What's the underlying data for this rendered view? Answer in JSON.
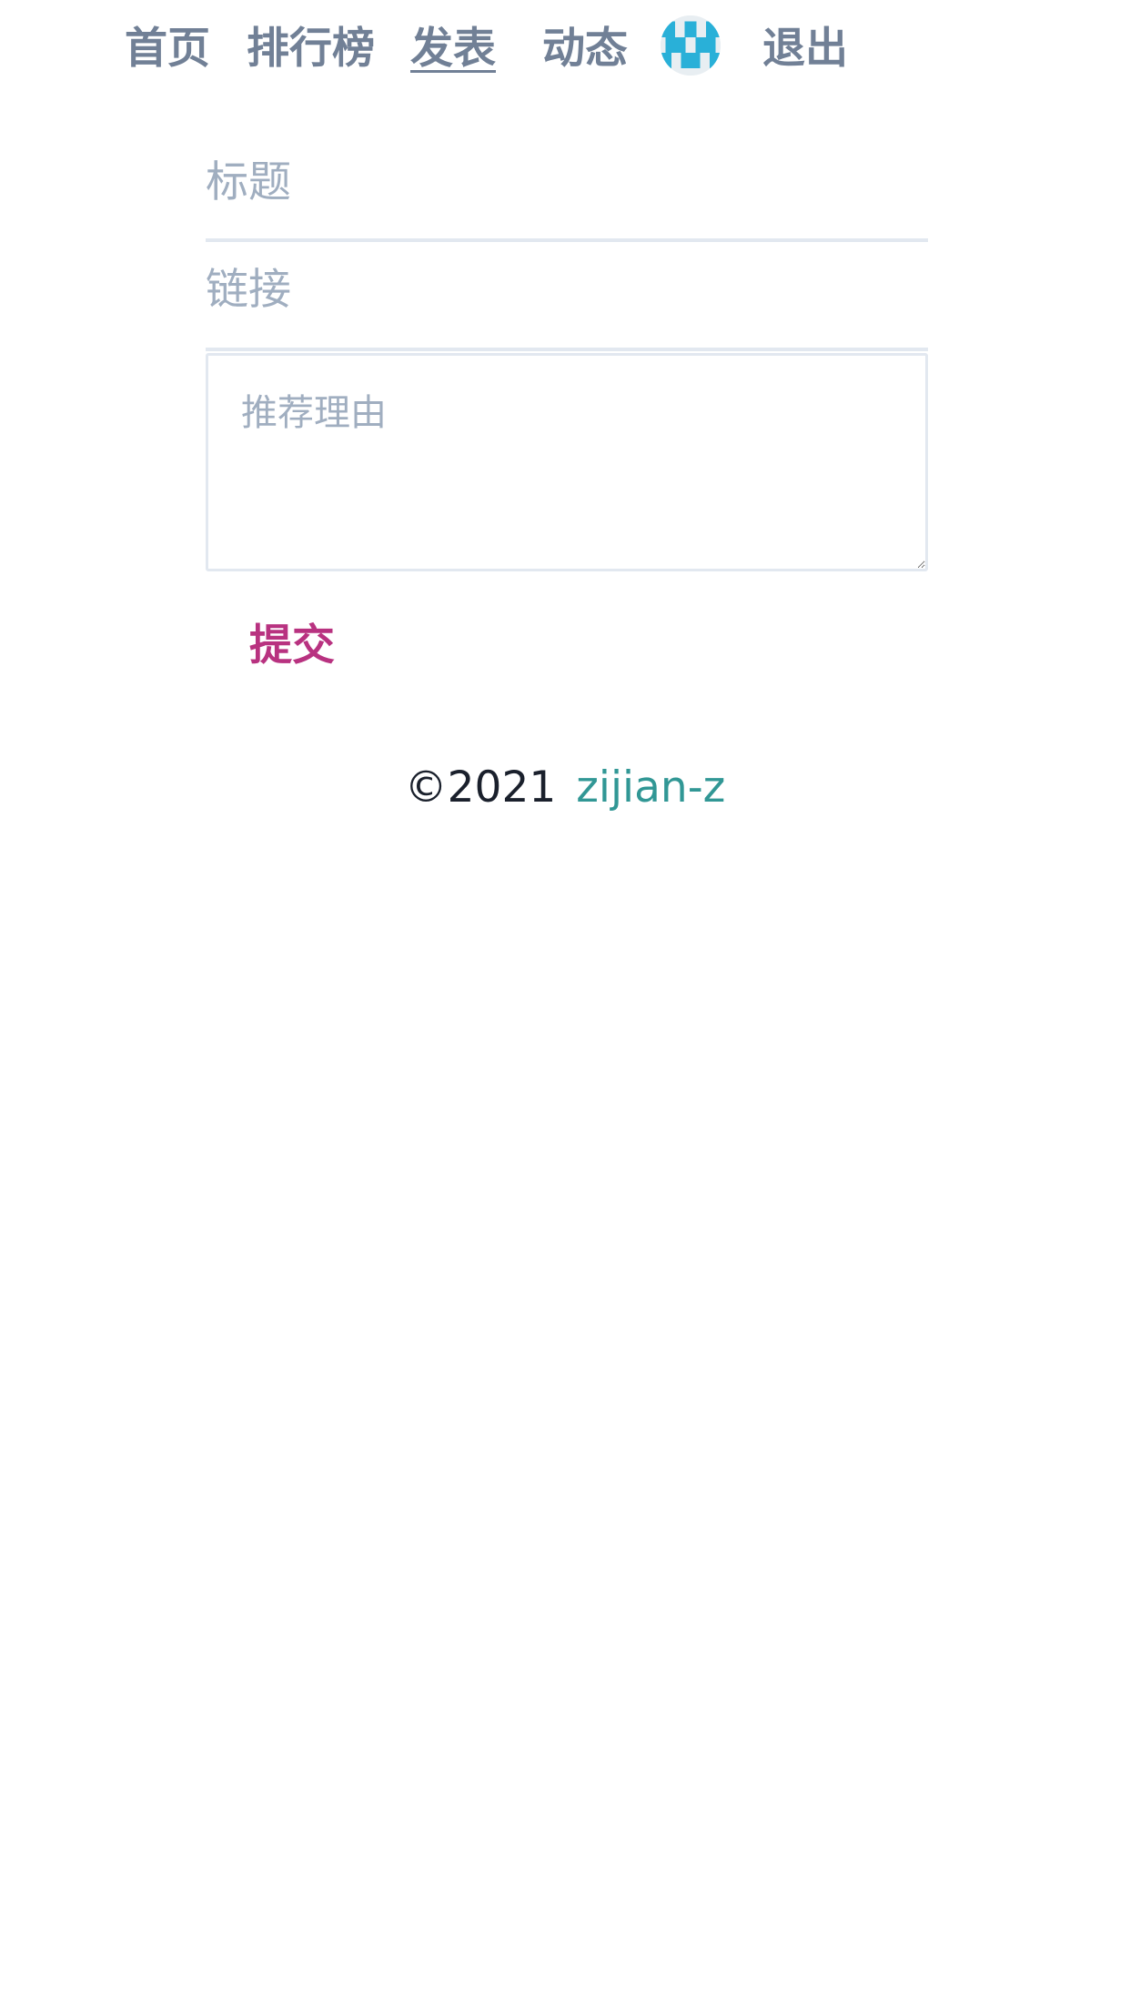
{
  "nav": {
    "home": "首页",
    "ranking": "排行榜",
    "publish": "发表",
    "activity": "动态",
    "avatar_alt": "avatar",
    "logout": "退出"
  },
  "form": {
    "title_placeholder": "标题",
    "link_placeholder": "链接",
    "reason_placeholder": "推荐理由",
    "submit_label": "提交"
  },
  "footer": {
    "copyright": "©2021",
    "author": "zijian-z"
  },
  "colors": {
    "nav_text": "#718096",
    "placeholder": "#a0aec0",
    "submit": "#b83280",
    "author_link": "#319795",
    "avatar_accent": "#29b0d8"
  }
}
